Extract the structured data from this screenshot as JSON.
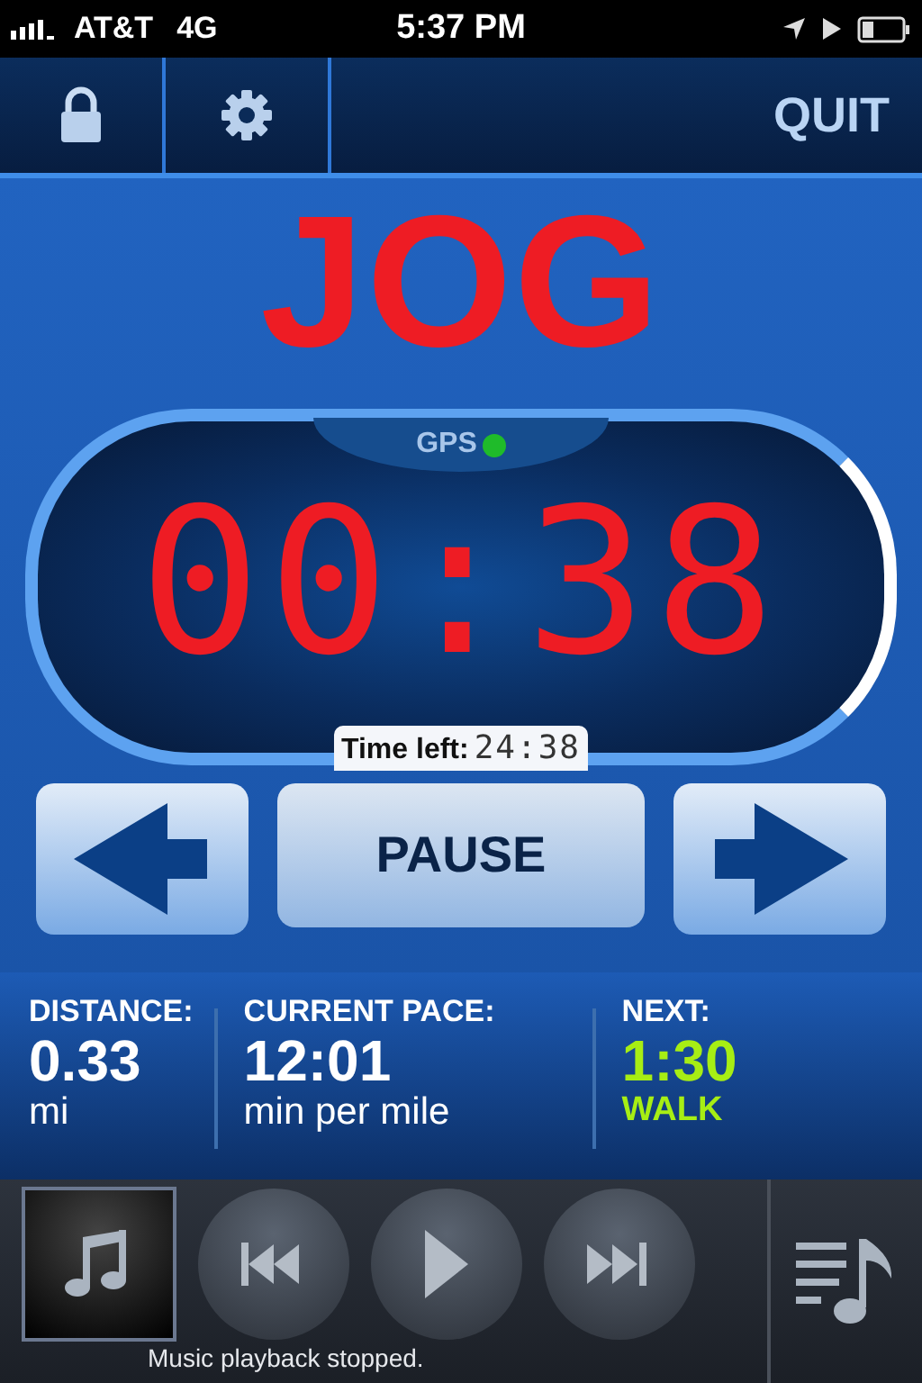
{
  "status_bar": {
    "carrier": "AT&T",
    "network": "4G",
    "time": "5:37 PM"
  },
  "toolbar": {
    "quit": "QUIT"
  },
  "mode": "JOG",
  "timer": {
    "gps_label": "GPS",
    "gps_fix": true,
    "elapsed": "00:38",
    "time_left_label": "Time left:",
    "time_left": "24:38"
  },
  "controls": {
    "pause": "PAUSE"
  },
  "stats": [
    {
      "label": "DISTANCE:",
      "value": "0.33",
      "unit": "mi",
      "highlight": false
    },
    {
      "label": "CURRENT PACE:",
      "value": "12:01",
      "unit": "min per mile",
      "highlight": false
    },
    {
      "label": "NEXT:",
      "value": "1:30",
      "unit": "WALK",
      "highlight": true
    }
  ],
  "music": {
    "status": "Music playback stopped."
  }
}
